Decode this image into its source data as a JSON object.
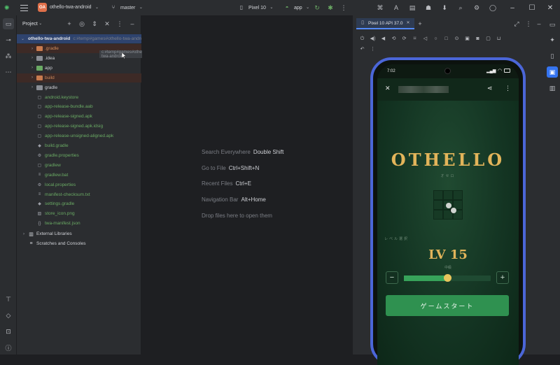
{
  "titlebar": {
    "project_badge": "OA",
    "project_name": "othello-twa-android",
    "branch": "master",
    "device": "Pixel 10",
    "run_config": "app"
  },
  "project_panel": {
    "title": "Project",
    "root_name": "othello-twa-android",
    "root_path": "c:#temp#games#othello-twa-android",
    "items": [
      {
        "label": ".gradle",
        "kind": "folder-excluded",
        "expandable": true
      },
      {
        "label": ".idea",
        "kind": "folder",
        "expandable": true
      },
      {
        "label": "app",
        "kind": "folder-module",
        "expandable": true
      },
      {
        "label": "build",
        "kind": "folder-excluded",
        "expandable": true
      },
      {
        "label": "gradle",
        "kind": "folder",
        "expandable": true
      },
      {
        "label": "android.keystore",
        "kind": "file"
      },
      {
        "label": "app-release-bundle.aab",
        "kind": "file"
      },
      {
        "label": "app-release-signed.apk",
        "kind": "file"
      },
      {
        "label": "app-release-signed.apk.idsig",
        "kind": "file"
      },
      {
        "label": "app-release-unsigned-aligned.apk",
        "kind": "file"
      },
      {
        "label": "build.gradle",
        "kind": "gradle"
      },
      {
        "label": "gradle.properties",
        "kind": "settings"
      },
      {
        "label": "gradlew",
        "kind": "file"
      },
      {
        "label": "gradlew.bat",
        "kind": "text"
      },
      {
        "label": "local.properties",
        "kind": "settings"
      },
      {
        "label": "manifest-checksum.txt",
        "kind": "text"
      },
      {
        "label": "settings.gradle",
        "kind": "gradle"
      },
      {
        "label": "store_icon.png",
        "kind": "image"
      },
      {
        "label": "twa-manifest.json",
        "kind": "json"
      }
    ],
    "external_libraries": "External Libraries",
    "scratches": "Scratches and Consoles"
  },
  "editor_hints": [
    {
      "label": "Search Everywhere",
      "shortcut": "Double Shift"
    },
    {
      "label": "Go to File",
      "shortcut": "Ctrl+Shift+N"
    },
    {
      "label": "Recent Files",
      "shortcut": "Ctrl+E"
    },
    {
      "label": "Navigation Bar",
      "shortcut": "Alt+Home"
    },
    {
      "label": "Drop files here to open them",
      "shortcut": ""
    }
  ],
  "running_devices": {
    "tab_label": "Pixel 10 API 37.0"
  },
  "phone": {
    "time": "7:02",
    "app_title": "OTHELLO",
    "subtitle": "オセロ",
    "level_label": "レベル選択",
    "level_value": "LV 15",
    "level_sub": "中級",
    "level_fraction": 0.5,
    "start_button": "ゲームスタート",
    "colors": {
      "gold": "#e2b45a",
      "accent_green": "#2f9150"
    }
  }
}
